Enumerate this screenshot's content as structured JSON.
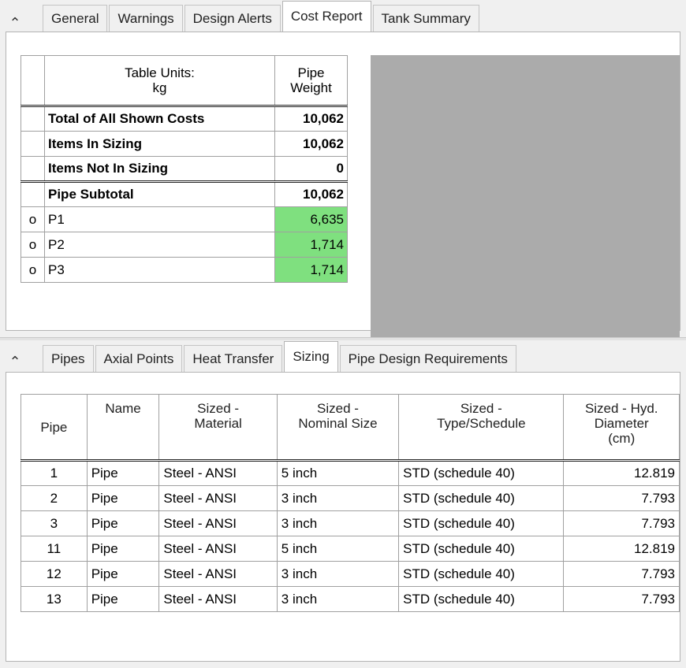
{
  "top_panel": {
    "collapse_glyph": "⌃",
    "tabs": [
      {
        "label": "General"
      },
      {
        "label": "Warnings"
      },
      {
        "label": "Design Alerts"
      },
      {
        "label": "Cost Report"
      },
      {
        "label": "Tank Summary"
      }
    ],
    "active_tab": "Cost Report",
    "table_units_header": "Table Units:\nkg",
    "pipe_weight_header": "Pipe\nWeight",
    "summary_rows": [
      {
        "label": "Total of All Shown Costs",
        "value": "10,062"
      },
      {
        "label": "Items In Sizing",
        "value": "10,062"
      },
      {
        "label": "Items Not In Sizing",
        "value": "0"
      },
      {
        "label": "Pipe Subtotal",
        "value": "10,062"
      }
    ],
    "pipe_rows": [
      {
        "marker": "o",
        "name": "P1",
        "value": "6,635"
      },
      {
        "marker": "o",
        "name": "P2",
        "value": "1,714"
      },
      {
        "marker": "o",
        "name": "P3",
        "value": "1,714"
      }
    ],
    "highlight_color": "#7fe07f"
  },
  "bottom_panel": {
    "collapse_glyph": "⌃",
    "tabs": [
      {
        "label": "Pipes"
      },
      {
        "label": "Axial Points"
      },
      {
        "label": "Heat Transfer"
      },
      {
        "label": "Sizing"
      },
      {
        "label": "Pipe Design Requirements"
      }
    ],
    "active_tab": "Sizing",
    "columns": [
      "Pipe",
      "Name",
      "Sized -\nMaterial",
      "Sized -\nNominal Size",
      "Sized -\nType/Schedule",
      "Sized - Hyd.\nDiameter\n(cm)"
    ],
    "rows": [
      {
        "pipe": "1",
        "name": "Pipe",
        "material": "Steel - ANSI",
        "size": "5 inch",
        "schedule": "STD (schedule 40)",
        "diameter": "12.819"
      },
      {
        "pipe": "2",
        "name": "Pipe",
        "material": "Steel - ANSI",
        "size": "3 inch",
        "schedule": "STD (schedule 40)",
        "diameter": "7.793"
      },
      {
        "pipe": "3",
        "name": "Pipe",
        "material": "Steel - ANSI",
        "size": "3 inch",
        "schedule": "STD (schedule 40)",
        "diameter": "7.793"
      },
      {
        "pipe": "11",
        "name": "Pipe",
        "material": "Steel - ANSI",
        "size": "5 inch",
        "schedule": "STD (schedule 40)",
        "diameter": "12.819"
      },
      {
        "pipe": "12",
        "name": "Pipe",
        "material": "Steel - ANSI",
        "size": "3 inch",
        "schedule": "STD (schedule 40)",
        "diameter": "7.793"
      },
      {
        "pipe": "13",
        "name": "Pipe",
        "material": "Steel - ANSI",
        "size": "3 inch",
        "schedule": "STD (schedule 40)",
        "diameter": "7.793"
      }
    ]
  }
}
